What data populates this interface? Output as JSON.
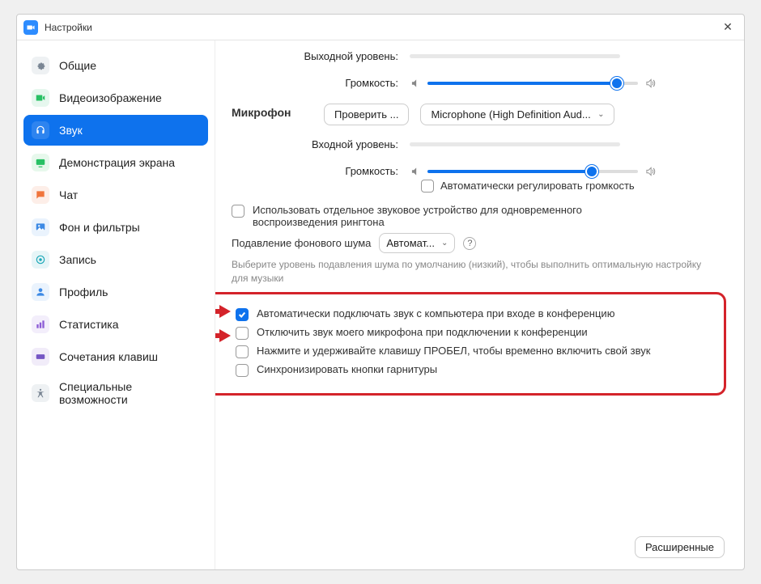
{
  "window": {
    "title": "Настройки"
  },
  "sidebar": {
    "items": [
      {
        "label": "Общие"
      },
      {
        "label": "Видеоизображение"
      },
      {
        "label": "Звук"
      },
      {
        "label": "Демонстрация экрана"
      },
      {
        "label": "Чат"
      },
      {
        "label": "Фон и фильтры"
      },
      {
        "label": "Запись"
      },
      {
        "label": "Профиль"
      },
      {
        "label": "Статистика"
      },
      {
        "label": "Сочетания клавиш"
      },
      {
        "label": "Специальные возможности"
      }
    ]
  },
  "audio": {
    "output_level_label": "Выходной уровень:",
    "volume_label": "Громкость:",
    "speaker_volume_pct": 90,
    "mic_section": "Микрофон",
    "test_button": "Проверить ...",
    "mic_device": "Microphone (High Definition Aud...",
    "input_level_label": "Входной уровень:",
    "mic_volume_pct": 78,
    "auto_adjust_volume": "Автоматически регулировать громкость",
    "separate_device": "Использовать отдельное звуковое устройство для одновременного воспроизведения рингтона",
    "noise_label": "Подавление фонового шума",
    "noise_value": "Автомат...",
    "noise_hint": "Выберите уровень подавления шума по умолчанию (низкий), чтобы выполнить оптимальную настройку для музыки",
    "opt_auto_join": "Автоматически подключать звук с компьютера при входе в конференцию",
    "opt_mute_mic": "Отключить звук моего микрофона при подключении к конференции",
    "opt_space_unmute": "Нажмите и удерживайте клавишу ПРОБЕЛ, чтобы временно включить свой звук",
    "opt_sync_headset": "Синхронизировать кнопки гарнитуры"
  },
  "footer": {
    "advanced": "Расширенные"
  }
}
